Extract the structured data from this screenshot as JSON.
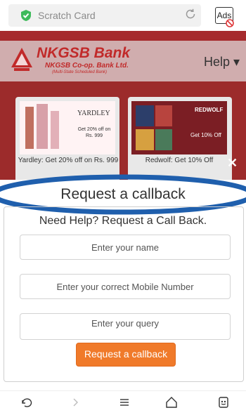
{
  "browser": {
    "url_label": "Scratch Card",
    "ads_label": "Ads"
  },
  "header": {
    "bank_name": "NKGSB Bank",
    "bank_line2": "NKGSB Co-op. Bank Ltd.",
    "bank_line3": "(Multi-State Scheduled Bank)",
    "help_label": "Help ▾"
  },
  "offers": [
    {
      "caption": "Yardley: Get 20% off on Rs. 999",
      "brand": "YARDLEY",
      "badge": "Get 20% off on Rs. 999"
    },
    {
      "caption": "Redwolf: Get 10% Off",
      "brand": "REDWOLF",
      "badge": "Get 10% Off"
    }
  ],
  "callback": {
    "title": "Request a callback",
    "subtitle": "Need Help? Request a Call Back.",
    "name_placeholder": "Enter your name",
    "mobile_placeholder": "Enter your correct Mobile Number",
    "query_placeholder": "Enter your query",
    "submit_label": "Request a callback",
    "close_symbol": "✕"
  },
  "colors": {
    "brand_red": "#a62a2d",
    "accent_orange": "#f07a2a",
    "highlight_blue": "#1f5fad",
    "shield_green": "#3dba5a"
  },
  "navigation": [
    "back-icon",
    "forward-icon",
    "menu-icon",
    "home-icon",
    "tabs-icon"
  ]
}
